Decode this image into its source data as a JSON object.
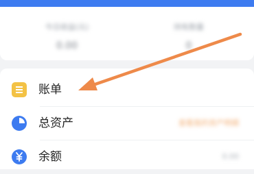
{
  "header": {
    "accent_color": "#3d7bf0"
  },
  "summary": {
    "left_label": "今日收益(元)",
    "left_value": "0.00",
    "right_label": "持有数量",
    "right_value": "0"
  },
  "menu": {
    "items": [
      {
        "label": "账单",
        "icon": "bill-icon",
        "color": "#f3c245",
        "extra": ""
      },
      {
        "label": "总资产",
        "icon": "pie-chart-icon",
        "color": "#3d7bf0",
        "extra": "查看我的资产明细",
        "extra_color": "#f3b27a"
      },
      {
        "label": "余额",
        "icon": "yuan-icon",
        "color": "#3d7bf0",
        "extra": "0.00",
        "extra_color": "#aab0b7"
      }
    ]
  },
  "annotation": {
    "arrow_color": "#ee8a4a",
    "arrow_target": "账单"
  }
}
